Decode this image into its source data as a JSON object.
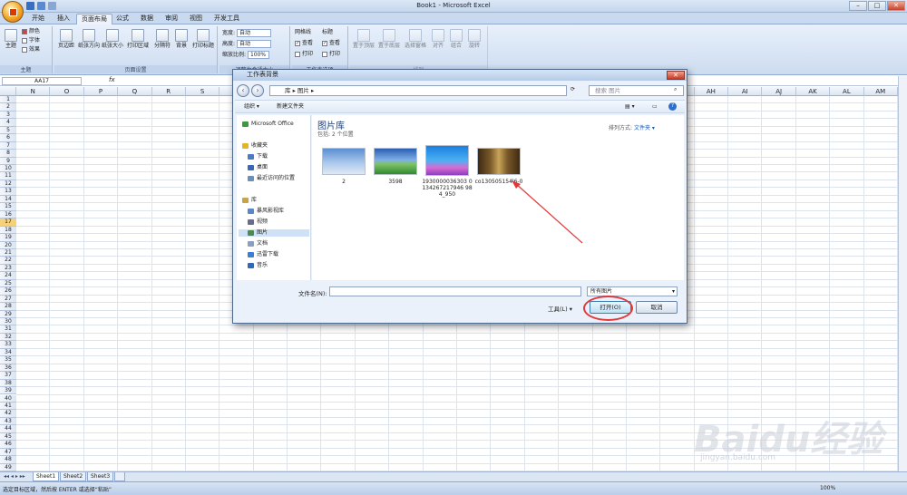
{
  "window": {
    "title": "Book1 - Microsoft Excel",
    "min": "–",
    "max": "□",
    "close": "✕"
  },
  "ribbon_tabs": [
    "开始",
    "插入",
    "页面布局",
    "公式",
    "数据",
    "审阅",
    "视图",
    "开发工具"
  ],
  "ribbon": {
    "themes": {
      "label": "主题",
      "colors": "颜色",
      "fonts": "字体",
      "effects": "效果",
      "group": "主题"
    },
    "page_setup": {
      "margins": "页边距",
      "orientation": "纸张方向",
      "size": "纸张大小",
      "print_area": "打印区域",
      "breaks": "分隔符",
      "background": "背景",
      "print_titles": "打印标题",
      "group": "页面设置"
    },
    "scale": {
      "width_label": "宽度:",
      "width_value": "自动",
      "height_label": "高度:",
      "height_value": "自动",
      "zoom_label": "缩放比例:",
      "zoom_value": "100%",
      "group": "调整为合适大小"
    },
    "sheet_options": {
      "gridlines": "网格线",
      "headings": "标题",
      "view": "查看",
      "print": "打印",
      "group": "工作表选项"
    },
    "arrange": {
      "bring_forward": "置于顶层",
      "send_backward": "置于底层",
      "selection_pane": "选择窗格",
      "align": "对齐",
      "group_btn": "组合",
      "rotate": "旋转",
      "group": "排列"
    }
  },
  "formula_bar": {
    "name_box": "AA17",
    "fx": "fx",
    "value": ""
  },
  "columns": [
    "N",
    "O",
    "P",
    "Q",
    "R",
    "S",
    "T",
    "U",
    "V",
    "W",
    "X",
    "Y",
    "Z",
    "AA",
    "AB",
    "AC",
    "AD",
    "AE",
    "AF",
    "AG",
    "AH",
    "AI",
    "AJ",
    "AK",
    "AL",
    "AM"
  ],
  "selected_row": 17,
  "sheets": [
    "Sheet1",
    "Sheet2",
    "Sheet3"
  ],
  "status_bar": {
    "message": "选定目标区域，然后按 ENTER 或选择“粘贴”",
    "zoom": "100%"
  },
  "dialog": {
    "title": "工作表背景",
    "close": "✕",
    "address": [
      "库",
      "图片"
    ],
    "search_placeholder": "搜索 图片",
    "organize": "组织 ▾",
    "new_folder": "新建文件夹",
    "nav": {
      "office": "Microsoft Office",
      "favorites": "收藏夹",
      "downloads": "下载",
      "desktop": "桌面",
      "recent": "最近访问的位置",
      "libraries": "库",
      "storm": "暴风影视库",
      "videos": "视频",
      "pictures": "图片",
      "documents": "文档",
      "xunlei": "迅雷下载",
      "music": "音乐"
    },
    "library_title": "图片库",
    "library_sub": "包括: 2 个位置",
    "sort_label": "排列方式:",
    "sort_value": "文件夹 ▾",
    "files": [
      {
        "name": "2"
      },
      {
        "name": "3598"
      },
      {
        "name": "1930000036303 0134267217946 984_950"
      },
      {
        "name": "co130505154l6-0"
      }
    ],
    "filename_label": "文件名(N):",
    "filename_value": "",
    "filetype": "所有图片",
    "tools": "工具(L)",
    "open": "打开(O)",
    "cancel": "取消"
  },
  "watermark": {
    "brand": "Baidu经验",
    "url": "jingyan.baidu.com"
  }
}
